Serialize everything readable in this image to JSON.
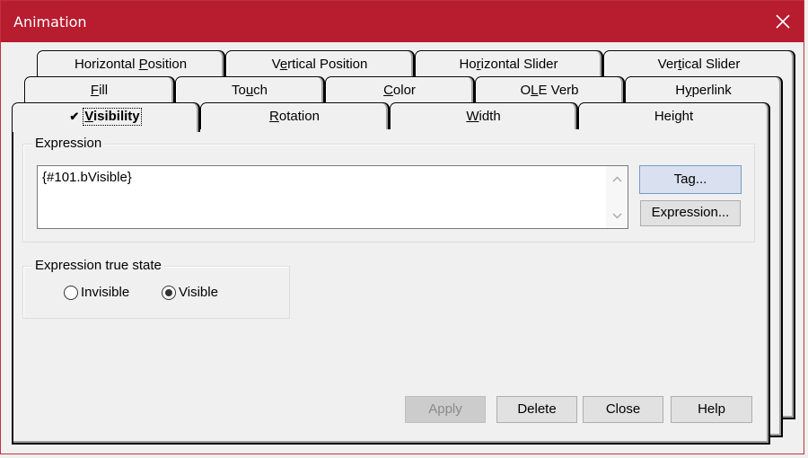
{
  "window": {
    "title": "Animation",
    "accent_color": "#b81c2f"
  },
  "tabs": {
    "row1": [
      {
        "label_pre": "Horizontal ",
        "accel": "P",
        "label_post": "osition"
      },
      {
        "label_pre": "V",
        "accel": "e",
        "label_post": "rtical Position"
      },
      {
        "label_pre": "Ho",
        "accel": "r",
        "label_post": "izontal Slider"
      },
      {
        "label_pre": "Ver",
        "accel": "t",
        "label_post": "ical Slider"
      }
    ],
    "row2": [
      {
        "label_pre": "",
        "accel": "F",
        "label_post": "ill"
      },
      {
        "label_pre": "To",
        "accel": "u",
        "label_post": "ch"
      },
      {
        "label_pre": "",
        "accel": "C",
        "label_post": "olor"
      },
      {
        "label_pre": "O",
        "accel": "L",
        "label_post": "E Verb"
      },
      {
        "label_pre": "H",
        "accel": "y",
        "label_post": "perlink"
      }
    ],
    "row3": [
      {
        "label_pre": "",
        "accel": "V",
        "label_post": "isibility",
        "active": true,
        "checked": true
      },
      {
        "label_pre": "",
        "accel": "R",
        "label_post": "otation"
      },
      {
        "label_pre": "",
        "accel": "W",
        "label_post": "idth"
      },
      {
        "label_pre": "Hei",
        "accel": "g",
        "label_post": "ht"
      }
    ]
  },
  "expression_group": {
    "label": "Expression",
    "value": "{#101.bVisible}",
    "tag_button": "Tag...",
    "expression_button": "Expression..."
  },
  "true_state_group": {
    "label": "Expression true state",
    "options": [
      {
        "label": "Invisible",
        "selected": false
      },
      {
        "label": "Visible",
        "selected": true
      }
    ]
  },
  "buttons": {
    "apply": "Apply",
    "delete": "Delete",
    "close": "Close",
    "help": "Help"
  },
  "icons": {
    "check": "✔"
  }
}
